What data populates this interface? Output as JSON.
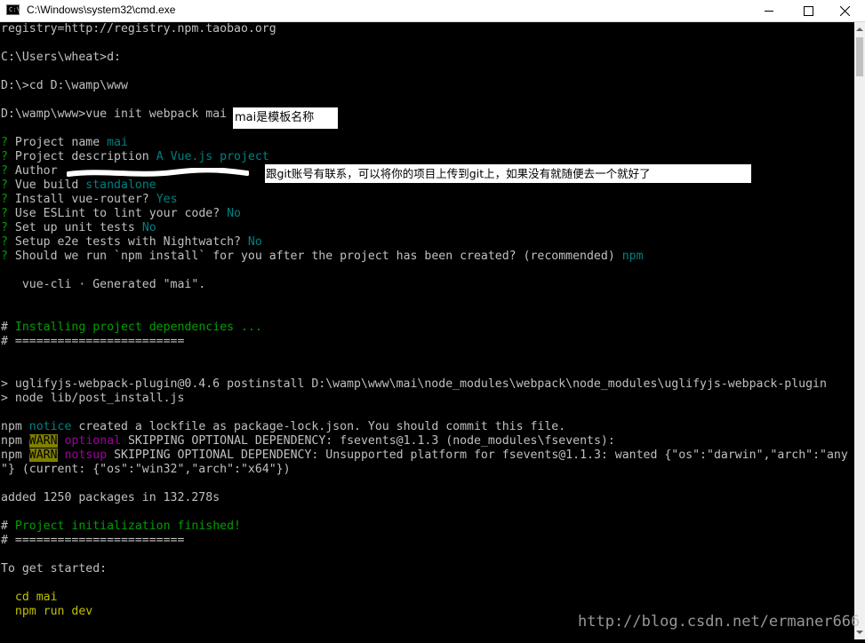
{
  "window": {
    "title": "C:\\Windows\\system32\\cmd.exe",
    "icon_text": "C:\\"
  },
  "terminal": {
    "l01": "registry=http://registry.npm.taobao.org",
    "l02": "C:\\Users\\wheat>d:",
    "l03": "D:\\>cd D:\\wamp\\www",
    "l04": "D:\\wamp\\www>vue init webpack mai",
    "q1_mark": "?",
    "q1_label": " Project name ",
    "q1_value": "mai",
    "q2_mark": "?",
    "q2_label": " Project description ",
    "q2_value": "A Vue.js project",
    "q3_mark": "?",
    "q3_label": " Author ",
    "q4_mark": "?",
    "q4_label": " Vue build ",
    "q4_value": "standalone",
    "q5_mark": "?",
    "q5_label": " Install vue-router? ",
    "q5_value": "Yes",
    "q6_mark": "?",
    "q6_label": " Use ESLint to lint your code? ",
    "q6_value": "No",
    "q7_mark": "?",
    "q7_label": " Set up unit tests ",
    "q7_value": "No",
    "q8_mark": "?",
    "q8_label": " Setup e2e tests with Nightwatch? ",
    "q8_value": "No",
    "q9_mark": "?",
    "q9_label": " Should we run `npm install` for you after the project has been created? (recommended) ",
    "q9_value": "npm",
    "generated": "   vue-cli · Generated \"mai\".",
    "install_hash": "#",
    "install_text": " Installing project dependencies ...",
    "rule1": "# ========================",
    "post1": "> uglifyjs-webpack-plugin@0.4.6 postinstall D:\\wamp\\www\\mai\\node_modules\\webpack\\node_modules\\uglifyjs-webpack-plugin",
    "post2": "> node lib/post_install.js",
    "npm": "npm",
    "notice": "notice",
    "notice_text": " created a lockfile as package-lock.json. You should commit this file.",
    "warn": "WARN",
    "optional": "optional",
    "optional_text": " SKIPPING OPTIONAL DEPENDENCY: fsevents@1.1.3 (node_modules\\fsevents):",
    "notsup": "notsup",
    "notsup_text": " SKIPPING OPTIONAL DEPENDENCY: Unsupported platform for fsevents@1.1.3: wanted {\"os\":\"darwin\",\"arch\":\"any",
    "notsup_cont": "\"} (current: {\"os\":\"win32\",\"arch\":\"x64\"})",
    "added": "added 1250 packages in 132.278s",
    "finish_hash": "#",
    "finish_text": " Project initialization finished!",
    "rule2": "# ========================",
    "started": "To get started:",
    "cd_cmd": "  cd mai",
    "run_cmd": "  npm run dev"
  },
  "annotations": {
    "template_note": "mai是模板名称",
    "author_note": "跟git账号有联系，可以将你的项目上传到git上，如果没有就随便去一个就好了"
  },
  "watermark": "http://blog.csdn.net/ermaner666",
  "colors": {
    "background": "#000000",
    "text": "#c0c0c0",
    "yellow": "#c0c000",
    "green": "#00a000",
    "teal": "#008080",
    "magenta": "#a000a0",
    "warn_bg": "#808000"
  }
}
